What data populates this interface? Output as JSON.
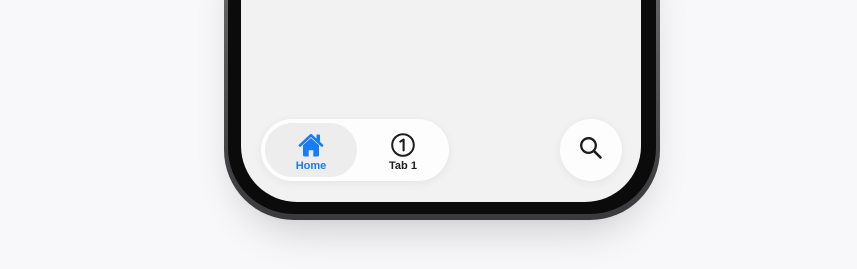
{
  "tab_bar": {
    "tabs": [
      {
        "label": "Home",
        "icon": "house-fill-icon",
        "selected": true
      },
      {
        "label": "Tab 1",
        "icon": "number-1-circle-icon",
        "selected": false
      }
    ]
  },
  "search_button": {
    "icon": "magnifyingglass-icon"
  },
  "colors": {
    "accent": "#1a7cf2",
    "screen_background": "#f2f2f2",
    "page_background": "#f8f8fa"
  }
}
